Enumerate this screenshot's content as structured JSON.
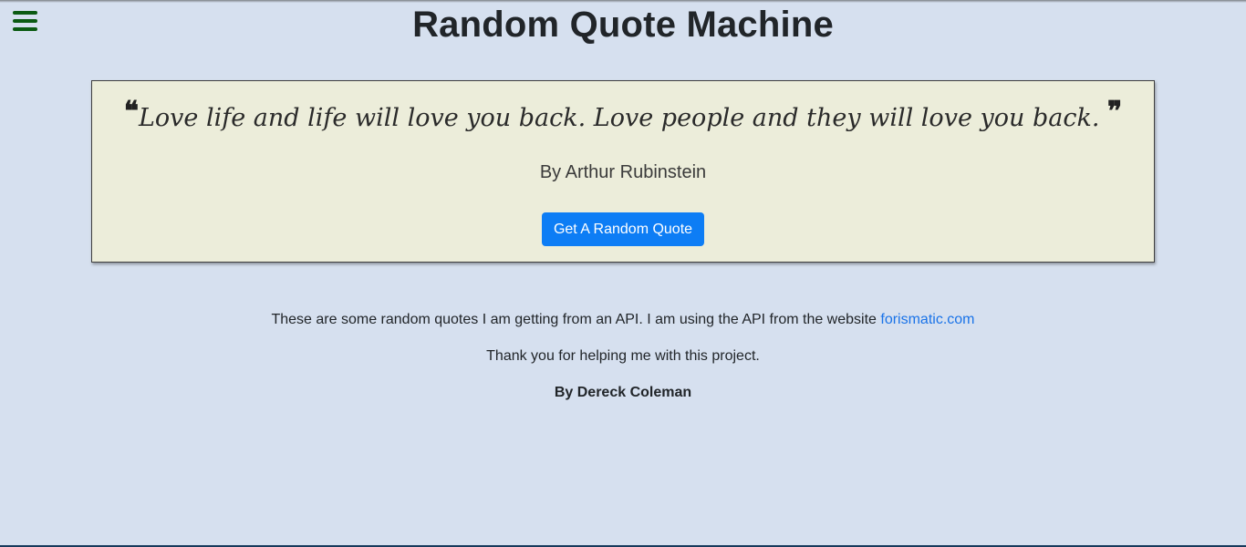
{
  "header": {
    "title": "Random Quote Machine",
    "menu_icon": "hamburger-menu-icon"
  },
  "quote": {
    "open_mark": "❝",
    "text": "Love life and life will love you back. Love people and they will love you back. ",
    "close_mark": "❞",
    "author": "By Arthur Rubinstein",
    "button_label": "Get A Random Quote"
  },
  "info": {
    "line1_text": "These are some random quotes I am getting from an API. I am using the API from the website ",
    "line1_link": "forismatic.com",
    "line2": "Thank you for helping me with this project.",
    "line3": "By Dereck Coleman"
  },
  "colors": {
    "background": "#d6e0ef",
    "quote_box": "#ecedda",
    "button": "#0d7df5",
    "link": "#1a73e8",
    "menu_icon": "#0b5a12"
  }
}
